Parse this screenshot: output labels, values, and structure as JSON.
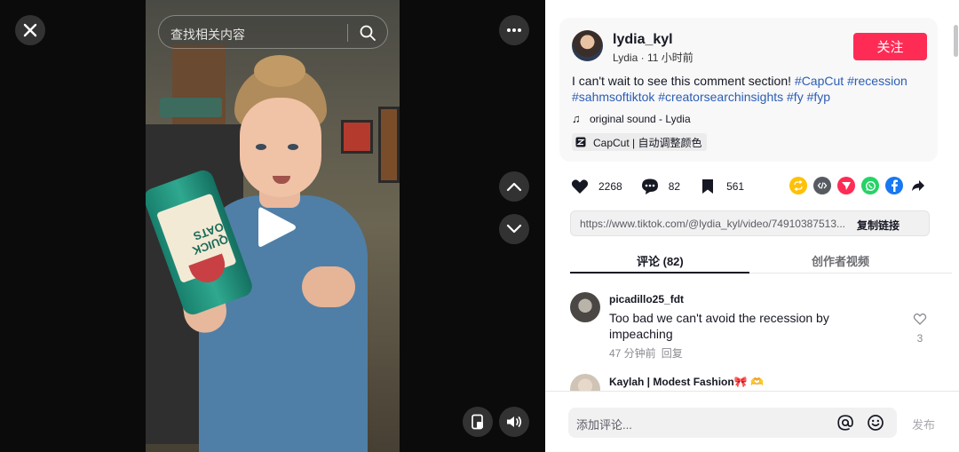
{
  "video": {
    "search_placeholder": "查找相关内容",
    "can_text": "QUICK OATS"
  },
  "author": {
    "username": "lydia_kyl",
    "display_name": "Lydia",
    "time_ago": "11 小时前",
    "follow_label": "关注"
  },
  "caption": {
    "text": "I can't wait to see this comment section!",
    "hashtags": [
      "#CapCut",
      "#recession",
      "#sahmsoftiktok",
      "#creatorsearchinsights",
      "#fy",
      "#fyp"
    ]
  },
  "sound": {
    "label": "original sound - Lydia"
  },
  "capcut": {
    "label": "CapCut | 自动调整颜色"
  },
  "stats": {
    "likes": "2268",
    "comments": "82",
    "saves": "561"
  },
  "share": {
    "icons": [
      "repost-icon",
      "embed-icon",
      "send-icon",
      "whatsapp-icon",
      "facebook-icon",
      "share-arrow-icon"
    ],
    "colors": [
      "#ffc107",
      "#555b61",
      "#fe2c55",
      "#25d366",
      "#1877f2",
      "#161823"
    ]
  },
  "link": {
    "url": "https://www.tiktok.com/@lydia_kyl/video/74910387513...",
    "copy_label": "复制链接"
  },
  "tabs": {
    "comments": "评论 (82)",
    "creator_videos": "创作者视频"
  },
  "comments": [
    {
      "user": "picadillo25_fdt",
      "text": "Too bad we can't avoid the recession by impeaching",
      "time": "47 分钟前",
      "reply": "回复",
      "likes": "3"
    },
    {
      "user": "Kaylah | Modest Fashion🎀 🫶"
    }
  ],
  "composer": {
    "placeholder": "添加评论...",
    "post_label": "发布"
  },
  "colors": {
    "accent": "#fe2c55",
    "hashtag": "#2b5db5"
  }
}
